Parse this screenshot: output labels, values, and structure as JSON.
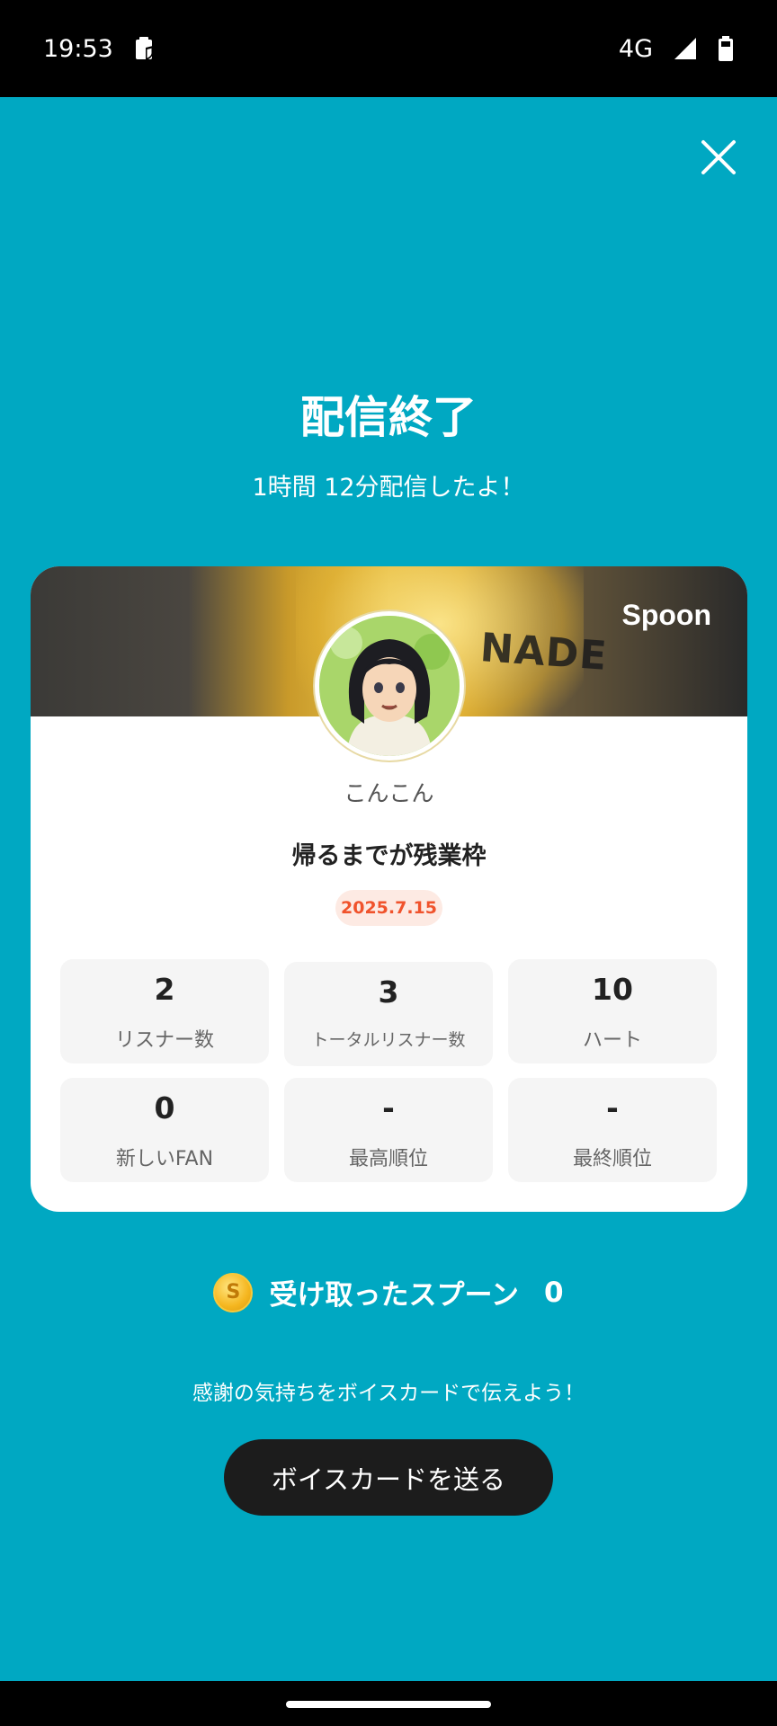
{
  "status_bar": {
    "time": "19:53",
    "network": "4G"
  },
  "header": {
    "title": "配信終了",
    "subtitle": "1時間 12分配信したよ！"
  },
  "card": {
    "brand": "Spoon",
    "banner_text": "NADE",
    "username": "こんこん",
    "live_title": "帰るまでが残業枠",
    "date": "2025.7.15",
    "stats": [
      {
        "value": "2",
        "label": "リスナー数"
      },
      {
        "value": "3",
        "label": "トータルリスナー数"
      },
      {
        "value": "10",
        "label": "ハート"
      },
      {
        "value": "0",
        "label": "新しいFAN"
      },
      {
        "value": "-",
        "label": "最高順位"
      },
      {
        "value": "-",
        "label": "最終順位"
      }
    ]
  },
  "spoons": {
    "coin_glyph": "S",
    "label": "受け取ったスプーン",
    "count": "0"
  },
  "thanks_text": "感謝の気持ちをボイスカードで伝えよう！",
  "voice_button_label": "ボイスカードを送る",
  "colors": {
    "background": "#00A8C2",
    "date_badge_text": "#F0532C",
    "button": "#1C1C1C"
  }
}
